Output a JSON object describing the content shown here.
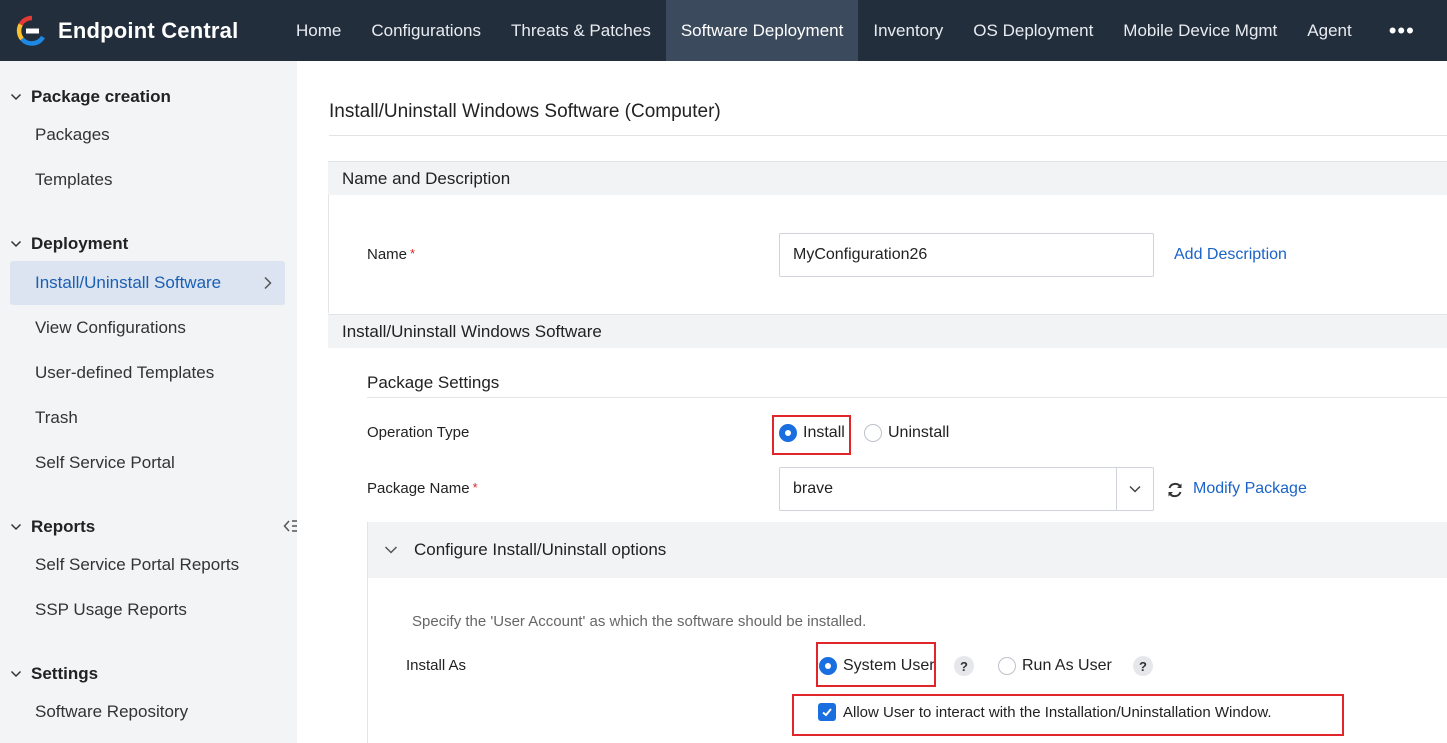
{
  "app": {
    "brand_name": "Endpoint Central",
    "nav": [
      {
        "label": "Home"
      },
      {
        "label": "Configurations"
      },
      {
        "label": "Threats & Patches"
      },
      {
        "label": "Software Deployment"
      },
      {
        "label": "Inventory"
      },
      {
        "label": "OS Deployment"
      },
      {
        "label": "Mobile Device Mgmt"
      },
      {
        "label": "Agent"
      }
    ],
    "more_label": "•••"
  },
  "sidebar": {
    "sections": [
      {
        "label": "Package creation",
        "items": [
          {
            "label": "Packages"
          },
          {
            "label": "Templates"
          }
        ]
      },
      {
        "label": "Deployment",
        "items": [
          {
            "label": "Install/Uninstall Software"
          },
          {
            "label": "View Configurations"
          },
          {
            "label": "User-defined Templates"
          },
          {
            "label": "Trash"
          },
          {
            "label": "Self Service Portal"
          }
        ]
      },
      {
        "label": "Reports",
        "items": [
          {
            "label": "Self Service Portal Reports"
          },
          {
            "label": "SSP Usage Reports"
          }
        ]
      },
      {
        "label": "Settings",
        "items": [
          {
            "label": "Software Repository"
          }
        ]
      }
    ],
    "active_item": "Install/Uninstall Software"
  },
  "main": {
    "page_title": "Install/Uninstall Windows Software (Computer)",
    "name_section": {
      "header": "Name and Description",
      "name_label": "Name",
      "required_mark": "*",
      "name_value": "MyConfiguration26",
      "add_description": "Add Description"
    },
    "software_section": {
      "header": "Install/Uninstall Windows Software",
      "package_settings": "Package Settings",
      "operation_type_label": "Operation Type",
      "operation_options": [
        {
          "label": "Install",
          "checked": true
        },
        {
          "label": "Uninstall",
          "checked": false
        }
      ],
      "package_name_label": "Package Name",
      "package_value": "brave",
      "modify_package": "Modify Package"
    },
    "options": {
      "header": "Configure Install/Uninstall options",
      "hint": "Specify the 'User Account' as which the software should be installed.",
      "install_as_label": "Install As",
      "install_as_options": [
        {
          "label": "System User",
          "checked": true
        },
        {
          "label": "Run As User",
          "checked": false
        }
      ],
      "help_glyph": "?",
      "allow_interact_label": "Allow User to interact with the Installation/Uninstallation Window.",
      "allow_interact_checked": true
    }
  },
  "colors": {
    "topbar": "#232e3c",
    "active_nav": "#3b4a5c",
    "link": "#1a63c9",
    "highlight_box": "#e0262b",
    "accent": "#1a6fe0"
  },
  "icons": [
    "endpoint-central-logo",
    "chevron-down-icon",
    "chevron-right-icon",
    "collapse-sidebar-icon",
    "refresh-icon",
    "caret-down-icon",
    "help-icon",
    "checkmark-icon"
  ]
}
